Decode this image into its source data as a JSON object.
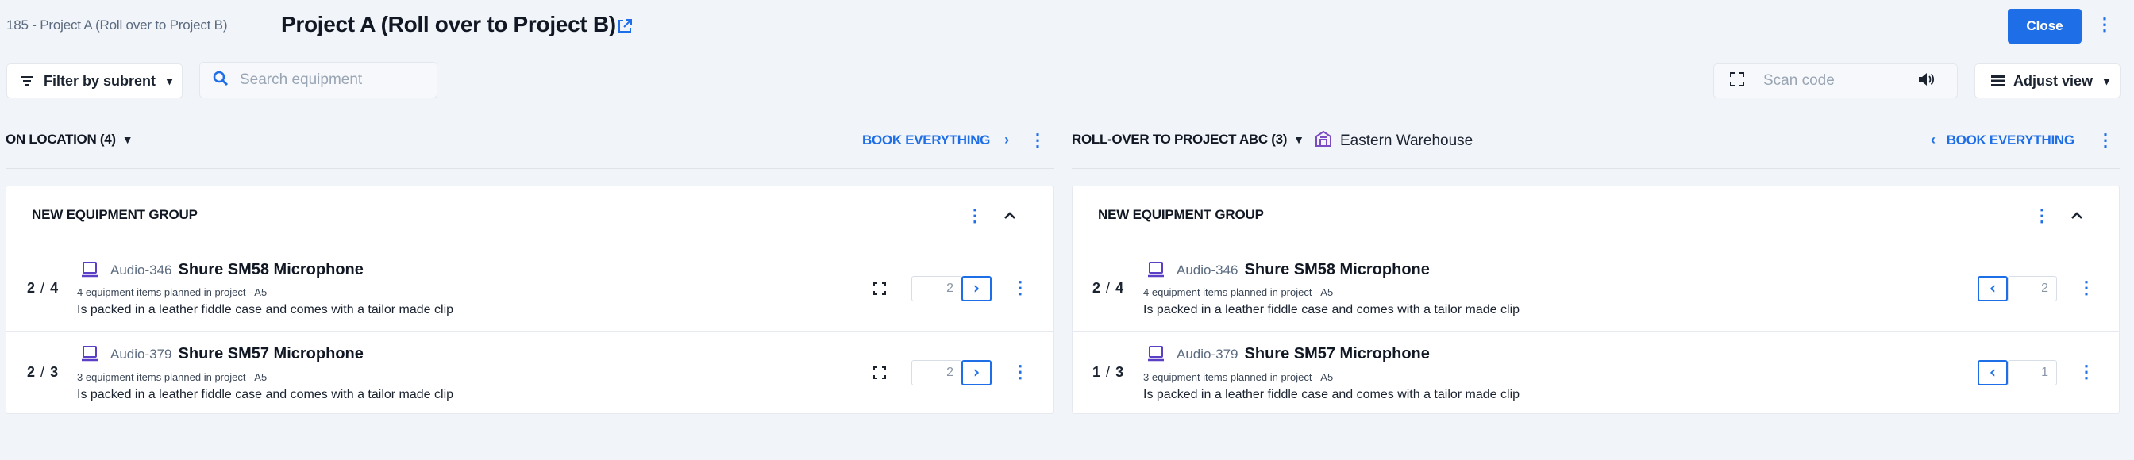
{
  "header": {
    "breadcrumb": "185 - Project A (Roll over to Project B)",
    "title": "Project A (Roll over to Project B)",
    "close_label": "Close"
  },
  "toolbar": {
    "filter_label": "Filter by subrent",
    "search_placeholder": "Search equipment",
    "scan_placeholder": "Scan code",
    "adjust_label": "Adjust view"
  },
  "left": {
    "heading": "ON LOCATION (4)",
    "book_label": "BOOK EVERYTHING",
    "group_title": "NEW EQUIPMENT GROUP",
    "items": [
      {
        "done": "2",
        "total": "4",
        "code": "Audio-346",
        "name": "Shure SM58 Microphone",
        "planned": "4 equipment items planned in project - A5",
        "desc": "Is packed in a leather fiddle case and comes with a tailor made clip",
        "qty": "2"
      },
      {
        "done": "2",
        "total": "3",
        "code": "Audio-379",
        "name": "Shure SM57 Microphone",
        "planned": "3 equipment items planned in project - A5",
        "desc": "Is packed in a leather fiddle case and comes with a tailor made clip",
        "qty": "2"
      }
    ]
  },
  "right": {
    "heading": "ROLL-OVER TO PROJECT ABC (3)",
    "warehouse": "Eastern Warehouse",
    "book_label": "BOOK EVERYTHING",
    "group_title": "NEW EQUIPMENT GROUP",
    "items": [
      {
        "done": "2",
        "total": "4",
        "code": "Audio-346",
        "name": "Shure SM58 Microphone",
        "planned": "4 equipment items planned in project - A5",
        "desc": "Is packed in a leather fiddle case and comes with a tailor made clip",
        "qty": "2"
      },
      {
        "done": "1",
        "total": "3",
        "code": "Audio-379",
        "name": "Shure SM57 Microphone",
        "planned": "3 equipment items planned in project - A5",
        "desc": "Is packed in a leather fiddle case and comes with a tailor made clip",
        "qty": "1"
      }
    ]
  },
  "colors": {
    "accent": "#1e6ee8",
    "background": "#f1f4f8",
    "panel": "#ffffff",
    "warehouse_icon": "#7b4bc4"
  }
}
